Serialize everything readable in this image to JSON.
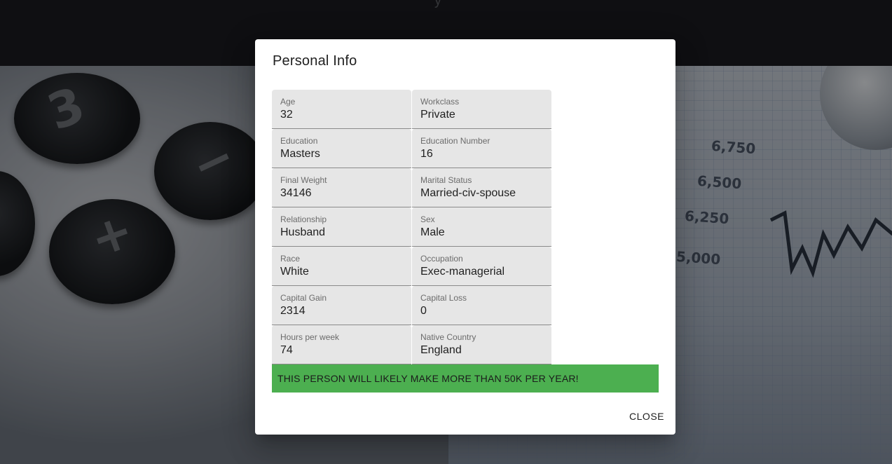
{
  "topbar": {
    "partial_text": "y"
  },
  "background": {
    "calculator_keys": [
      "3",
      "−",
      "+"
    ],
    "chart_numbers": [
      "6,750",
      "6,500",
      "6,250",
      "5,000"
    ]
  },
  "dialog": {
    "title": "Personal Info",
    "fields": [
      [
        {
          "label": "Age",
          "value": "32"
        },
        {
          "label": "Workclass",
          "value": "Private"
        }
      ],
      [
        {
          "label": "Education",
          "value": "Masters"
        },
        {
          "label": "Education Number",
          "value": "16"
        }
      ],
      [
        {
          "label": "Final Weight",
          "value": "34146"
        },
        {
          "label": "Marital Status",
          "value": "Married-civ-spouse"
        }
      ],
      [
        {
          "label": "Relationship",
          "value": "Husband"
        },
        {
          "label": "Sex",
          "value": "Male"
        }
      ],
      [
        {
          "label": "Race",
          "value": "White"
        },
        {
          "label": "Occupation",
          "value": "Exec-managerial"
        }
      ],
      [
        {
          "label": "Capital Gain",
          "value": "2314"
        },
        {
          "label": "Capital Loss",
          "value": "0"
        }
      ],
      [
        {
          "label": "Hours per week",
          "value": "74"
        },
        {
          "label": "Native Country",
          "value": "England"
        }
      ]
    ],
    "result_text": "THIS PERSON WILL LIKELY MAKE MORE THAN 50K PER YEAR!",
    "result_color": "#4caf50",
    "close_label": "CLOSE"
  }
}
